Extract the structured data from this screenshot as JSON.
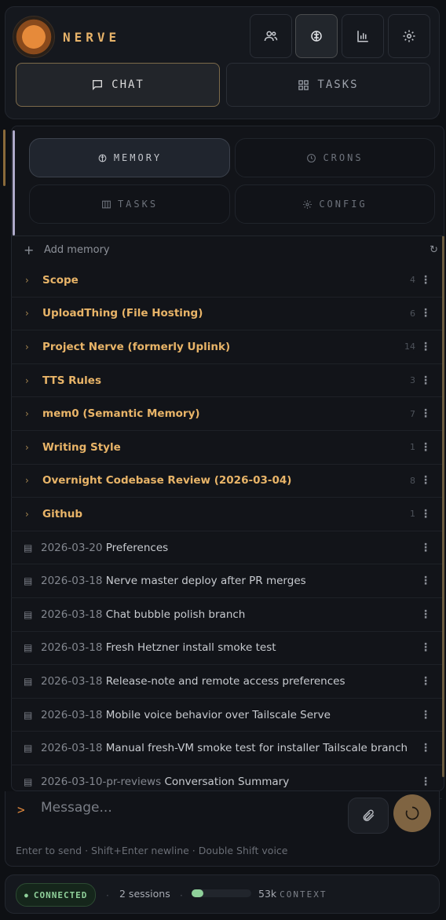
{
  "header": {
    "brand": "NERVE",
    "icons": [
      "users-icon",
      "brain-icon",
      "bar-chart-icon",
      "gear-icon"
    ]
  },
  "main_tabs": [
    {
      "label": "CHAT",
      "icon": "chat-bubble-icon",
      "active": true
    },
    {
      "label": "TASKS",
      "icon": "grid-icon",
      "active": false
    }
  ],
  "sub_tabs": [
    {
      "label": "MEMORY",
      "icon": "brain-icon",
      "active": true
    },
    {
      "label": "CRONS",
      "icon": "clock-icon",
      "active": false
    },
    {
      "label": "TASKS",
      "icon": "columns-icon",
      "active": false
    },
    {
      "label": "CONFIG",
      "icon": "gear-icon",
      "active": false
    }
  ],
  "memory": {
    "add_label": "Add memory",
    "groups": [
      {
        "title": "Scope",
        "count": "4"
      },
      {
        "title": "UploadThing (File Hosting)",
        "count": "6"
      },
      {
        "title": "Project Nerve (formerly Uplink)",
        "count": "14"
      },
      {
        "title": "TTS Rules",
        "count": "3"
      },
      {
        "title": "mem0 (Semantic Memory)",
        "count": "7"
      },
      {
        "title": "Writing Style",
        "count": "1"
      },
      {
        "title": "Overnight Codebase Review (2026-03-04)",
        "count": "8"
      },
      {
        "title": "Github",
        "count": "1"
      }
    ],
    "entries": [
      {
        "date": "2026-03-20",
        "title": "Preferences"
      },
      {
        "date": "2026-03-18",
        "title": "Nerve master deploy after PR merges"
      },
      {
        "date": "2026-03-18",
        "title": "Chat bubble polish branch"
      },
      {
        "date": "2026-03-18",
        "title": "Fresh Hetzner install smoke test"
      },
      {
        "date": "2026-03-18",
        "title": "Release-note and remote access preferences"
      },
      {
        "date": "2026-03-18",
        "title": "Mobile voice behavior over Tailscale Serve"
      },
      {
        "date": "2026-03-18",
        "title": "Manual fresh-VM smoke test for installer Tailscale branch"
      },
      {
        "date": "2026-03-10-pr-reviews",
        "title": "Conversation Summary"
      }
    ]
  },
  "composer": {
    "prompt": ">",
    "placeholder": "Message...",
    "hint": "Enter to send · Shift+Enter newline · Double Shift voice"
  },
  "status": {
    "connection": "CONNECTED",
    "sessions": "2 sessions",
    "context_value": "53k",
    "context_label": "CONTEXT",
    "context_fill": 0.2
  },
  "colors": {
    "accent": "#e8b468",
    "background": "#0e1014",
    "connected": "#8fd09a",
    "send_button": "#7f6442"
  }
}
